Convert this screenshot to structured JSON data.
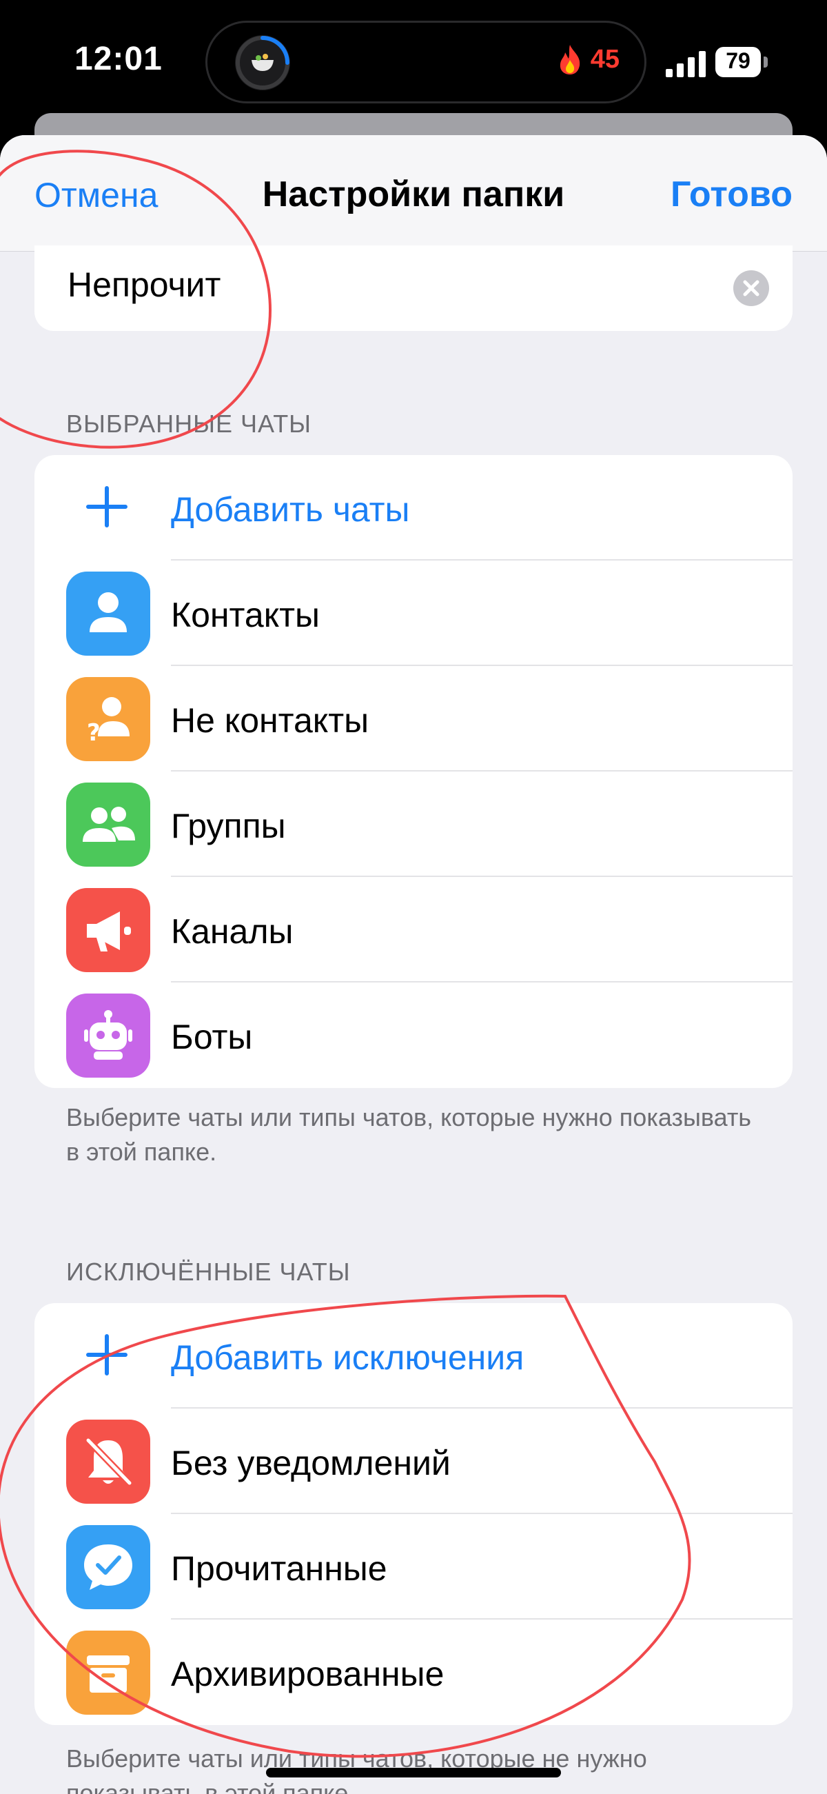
{
  "status_bar": {
    "time": "12:01",
    "streak_count": "45",
    "battery_level": "79"
  },
  "nav": {
    "cancel_label": "Отмена",
    "title": "Настройки папки",
    "done_label": "Готово"
  },
  "folder_name": {
    "value": "Непрочит"
  },
  "included": {
    "header": "ВЫБРАННЫЕ ЧАТЫ",
    "add_label": "Добавить чаты",
    "items": [
      {
        "label": "Контакты",
        "icon": "contacts-icon",
        "color": "#35a0f4"
      },
      {
        "label": "Не контакты",
        "icon": "non-contacts-icon",
        "color": "#f9a23b"
      },
      {
        "label": "Группы",
        "icon": "groups-icon",
        "color": "#4cc85a"
      },
      {
        "label": "Каналы",
        "icon": "channels-icon",
        "color": "#f5524a"
      },
      {
        "label": "Боты",
        "icon": "bots-icon",
        "color": "#c766e8"
      }
    ],
    "footer": "Выберите чаты или типы чатов, которые нужно показывать в этой папке."
  },
  "excluded": {
    "header": "ИСКЛЮЧЁННЫЕ ЧАТЫ",
    "add_label": "Добавить исключения",
    "items": [
      {
        "label": "Без уведомлений",
        "icon": "muted-bell-icon",
        "color": "#f5524a"
      },
      {
        "label": "Прочитанные",
        "icon": "read-check-icon",
        "color": "#35a0f4"
      },
      {
        "label": "Архивированные",
        "icon": "archive-icon",
        "color": "#f9a23b"
      }
    ],
    "footer": "Выберите чаты или типы чатов, которые не нужно показывать в этой папке."
  },
  "colors": {
    "accent": "#1a7ff5",
    "annotation": "#f0484c"
  }
}
